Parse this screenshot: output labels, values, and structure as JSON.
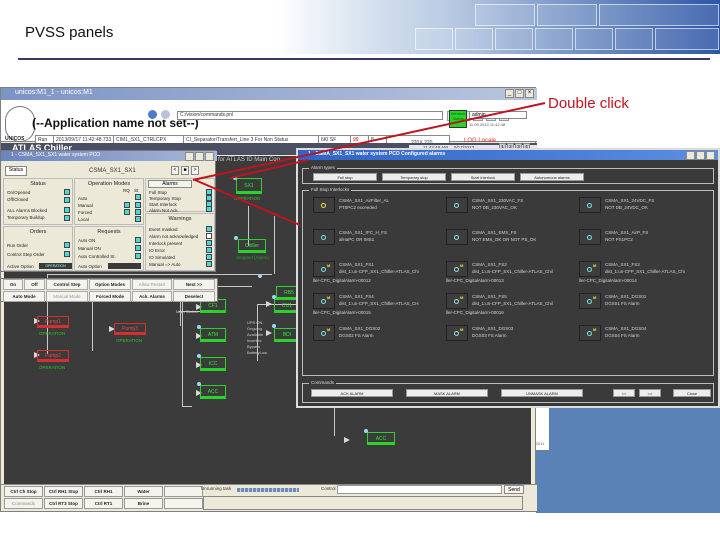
{
  "slide": {
    "title": "PVSS panels",
    "annotation": "Double click"
  },
  "main_window": {
    "title": "unicos:M1_1 - unicos:M1",
    "app_name": "(--Application name not set--)",
    "logo_text": "UNICOS",
    "panel_path": "C:/vision/commands.pnl",
    "info_row": [
      "Run",
      "2013/09/17 11:42:48.733",
      "CIM1_SX1_CTRLCPX",
      "CI_Separator/Transfert_Line 3 For Non Status",
      "6KI SF",
      "99",
      "8"
    ],
    "position_readout": "220X 220",
    "red_link": "LOG Locale",
    "window_status": "Window Status",
    "user": "admin",
    "user_sub": "11.09.2013 11:42:48",
    "header_title": "ATLAS Chiller",
    "sys_time": [
      "11:42:48 AM",
      "9/17/2013"
    ],
    "page_buttons": [
      "1",
      "2",
      "3",
      "4"
    ],
    "window_controls": [
      "_",
      "□",
      "×"
    ]
  },
  "synoptic": {
    "nodes": [
      {
        "id": "sx1",
        "label": "SX1",
        "status": "OPERATION",
        "color": "green"
      },
      {
        "id": "chiller",
        "label": "Chiller",
        "status": "Stopped (Alarm)",
        "color": "green"
      },
      {
        "id": "rb5",
        "label": "RB5",
        "status": "",
        "color": "green"
      },
      {
        "id": "pump1",
        "label": "Pump1",
        "status": "OPERATION",
        "color": "red"
      },
      {
        "id": "pump2",
        "label": "Pump2",
        "status": "OPERATION",
        "color": "red"
      },
      {
        "id": "pump3",
        "label": "Pump3",
        "status": "OPERATION",
        "color": "red"
      },
      {
        "id": "cf1",
        "label": "CF1",
        "status": "",
        "color": "green"
      },
      {
        "id": "atm",
        "label": "ATM",
        "status": "",
        "color": "green"
      },
      {
        "id": "icc",
        "label": "ICC",
        "status": "",
        "color": "green"
      },
      {
        "id": "acc",
        "label": "ACC",
        "status": "",
        "color": "green"
      },
      {
        "id": "cu1",
        "label": "CU1",
        "status": "",
        "color": "green"
      },
      {
        "id": "bdi",
        "label": "BDI",
        "status": "",
        "color": "green"
      },
      {
        "id": "acc2",
        "label": "ACC",
        "status": "",
        "color": "green"
      }
    ],
    "ups_list": [
      "UPS ON",
      "Ongoing",
      "Available",
      "Inverted",
      "Bypass",
      "BatteryLow"
    ],
    "side_label": "Main Station",
    "title_fragment": "for ATLAS ID Main Coo"
  },
  "bottom_bar": {
    "buttons_row1": [
      "Ctrl Ch Stop",
      "Ctrl RH1 Stop",
      "Ctrl RH1",
      "Water",
      ""
    ],
    "buttons_row2": [
      "Commands",
      "Ctrl RT3 Stop",
      "Ctrl RT1",
      "Brine",
      ""
    ],
    "message_label": "Unrunning task",
    "command_label": "Control",
    "command_value": "",
    "send_label": "Send"
  },
  "desktop": {
    "fragment": "09.2011"
  },
  "device_popup": {
    "title": "1 - CSMA_SX1_SX1 water system PCO",
    "tab": "Status",
    "device_name": "CSMA_SX1_SX1",
    "nav_buttons": [
      "<",
      "■",
      ">"
    ],
    "alarms_button": "Alarms",
    "status": {
      "header": "Status",
      "items": [
        {
          "label": "On/Opened",
          "on": true
        },
        {
          "label": "Off/Closed",
          "on": true
        },
        {
          "label": "ALL Alarms Blocked",
          "on": true
        },
        {
          "label": "Temporary Buildup",
          "on": true
        }
      ]
    },
    "operation_modes": {
      "header": "Operation Modes",
      "cols": [
        "RQ",
        "St"
      ],
      "items": [
        "Auto",
        "Manual",
        "Forced",
        "Local"
      ]
    },
    "alarms": {
      "items": [
        {
          "label": "Full Stop",
          "on": true
        },
        {
          "label": "Temporary Stop",
          "on": true
        },
        {
          "label": "Start Interlock",
          "on": true
        },
        {
          "label": "Alarm Not Ack.",
          "on": true
        }
      ]
    },
    "orders": {
      "header": "Orders",
      "items": [
        {
          "label": "Run Order",
          "on": true
        },
        {
          "label": "Control Step Order",
          "on": true
        }
      ],
      "active_option_label": "Active Option",
      "active_option_value": "OPERATION"
    },
    "requests": {
      "header": "Requests",
      "items": [
        {
          "label": "Auto ON",
          "on": true
        },
        {
          "label": "Manual ON",
          "on": true
        },
        {
          "label": "Auto Controlled St.",
          "on": true
        }
      ],
      "option_label": "Auto Option",
      "option_value": ""
    },
    "warnings": {
      "header": "Warnings",
      "items": [
        {
          "label": "Event masked",
          "on": true
        },
        {
          "label": "Alarm not acknowledged",
          "on": false
        },
        {
          "label": "Interlock present",
          "on": true
        },
        {
          "label": "IO Error",
          "on": true
        },
        {
          "label": "IO Simulated",
          "on": true
        },
        {
          "label": "Manual => Auto",
          "on": true
        }
      ]
    }
  },
  "command_bar": {
    "row1": [
      {
        "label": "On",
        "enabled": true
      },
      {
        "label": "Off",
        "enabled": true
      },
      {
        "label": "Control Step",
        "enabled": true
      },
      {
        "label": "Option Modes",
        "enabled": true
      },
      {
        "label": "Allow Restart",
        "enabled": false
      },
      {
        "label": "Next >>",
        "enabled": true
      }
    ],
    "row2": [
      {
        "label": "Auto Mode",
        "enabled": true
      },
      {
        "label": "Manual Mode",
        "enabled": false
      },
      {
        "label": "Forced Mode",
        "enabled": true
      },
      {
        "label": "Ack. Alarms",
        "enabled": true
      },
      {
        "label": "Deselect",
        "enabled": true
      }
    ]
  },
  "alarm_popup": {
    "title": "1 - CSMA_SX1_SX1 water system PCO Configured alarms",
    "alarm_types_label": "Alarm types",
    "alarm_type_buttons": [
      "Full stop",
      "Temporary stop",
      "Start interlock",
      "Autonomous alarms"
    ],
    "full_stop_label": "Full Stop Interlocks",
    "alarms": [
      {
        "name": "CSMA_SX1_AirFilter_AL",
        "desc": "PT0PC2 exceeded",
        "desc2": "",
        "active": true
      },
      {
        "name": "CSMA_SX1_230VAC_FS",
        "desc": "NOT DB_230VAC_OK",
        "desc2": "",
        "active": false
      },
      {
        "name": "CSMA_SX1_24VDC_FS",
        "desc": "NOT DB_24VDC_OK",
        "desc2": "",
        "active": false
      },
      {
        "name": "CSMA_SX1_IPC_H_FS",
        "desc": "alHaPC OR IMS1",
        "desc2": "",
        "active": false
      },
      {
        "name": "CSMA_SX1_EMS_FS",
        "desc": "NOT EMS_OK OR NOT PS_OK",
        "desc2": "",
        "active": false
      },
      {
        "name": "CSMA_SX1_AirP_FS",
        "desc": "NOT PS1PC2",
        "desc2": "",
        "active": false
      },
      {
        "name": "CSMA_SX1_FS1",
        "desc": "dist_1:un-CFP_SX1_Chiller-ATLAS_Chi",
        "desc2": "ller-CPC_DigitalAlarm-00012",
        "active": false,
        "m": true
      },
      {
        "name": "CSMA_SX1_FS2",
        "desc": "dist_1:un-CFP_SX1_Chiller-ATLAS_Chil",
        "desc2": "ller-CPC_DigitalAlarm-00013",
        "active": false,
        "m": true
      },
      {
        "name": "CSMA_SX1_FS3",
        "desc": "dist_1:un-CFP_SX1_Chiller-ATLAS_Chi",
        "desc2": "ller-CPC_DigitalAlarm-00014",
        "active": false,
        "m": true
      },
      {
        "name": "CSMA_SX1_FS4",
        "desc": "dist_1:un-CFP_SX1_Chiller-ATLAS_CH",
        "desc2": "ller-CPC_DigitalAlarm-00015",
        "active": false,
        "m": true
      },
      {
        "name": "CSMA_SX1_FS5",
        "desc": "dist_1:un-CFP_SX1_Chiller-ATLAS_Chil",
        "desc2": "ller-CPC_DigitalAlarm-00016",
        "active": false,
        "m": true
      },
      {
        "name": "CSMA_SX1_DGS01",
        "desc": "DGS01 FS Alarm",
        "desc2": "",
        "active": false,
        "m": true
      },
      {
        "name": "CSMA_SX1_DGS02",
        "desc": "DGS02 FS Alarm",
        "desc2": "",
        "active": false,
        "m": true
      },
      {
        "name": "CSMA_SX1_DGS03",
        "desc": "DGS03 FS Alarm",
        "desc2": "",
        "active": false,
        "m": true
      },
      {
        "name": "CSMA_SX1_DGS04",
        "desc": "DGS04 FS Alarm",
        "desc2": "",
        "active": false,
        "m": true
      }
    ],
    "commands_label": "Commands",
    "command_buttons": [
      "ACK ALARM",
      "MASK ALARM",
      "UNMASK ALARM",
      "<<",
      ">>",
      "Close"
    ]
  },
  "colors": {
    "annotation_red": "#c1121f",
    "ok_green": "#2bd22b",
    "fault_red": "#d52f2f",
    "led_cyan": "#4dd9d9",
    "window_status_green": "#29d229"
  }
}
